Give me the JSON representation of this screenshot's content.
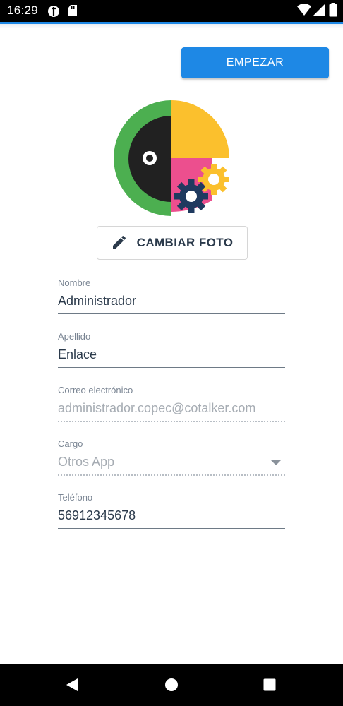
{
  "status_bar": {
    "time": "16:29",
    "icons": [
      "data-saver-icon",
      "sd-card-icon",
      "wifi-icon",
      "signal-icon",
      "battery-icon"
    ]
  },
  "header": {
    "start_label": "EMPEZAR",
    "accent_color": "#1e88e5"
  },
  "avatar": {
    "logo_colors": [
      "#4caf50",
      "#212121",
      "#fbc02d",
      "#ec4f8e",
      "#1f3a5f"
    ]
  },
  "change_photo": {
    "icon": "pencil-icon",
    "label": "CAMBIAR FOTO"
  },
  "form": {
    "first_name": {
      "label": "Nombre",
      "value": "Administrador"
    },
    "last_name": {
      "label": "Apellido",
      "value": "Enlace"
    },
    "email": {
      "label": "Correo electrónico",
      "value": "administrador.copec@cotalker.com"
    },
    "position": {
      "label": "Cargo",
      "value": "Otros App"
    },
    "phone": {
      "label": "Teléfono",
      "value": "56912345678"
    }
  },
  "nav_bar": {
    "icons": [
      "back-icon",
      "home-icon",
      "recents-icon"
    ]
  }
}
